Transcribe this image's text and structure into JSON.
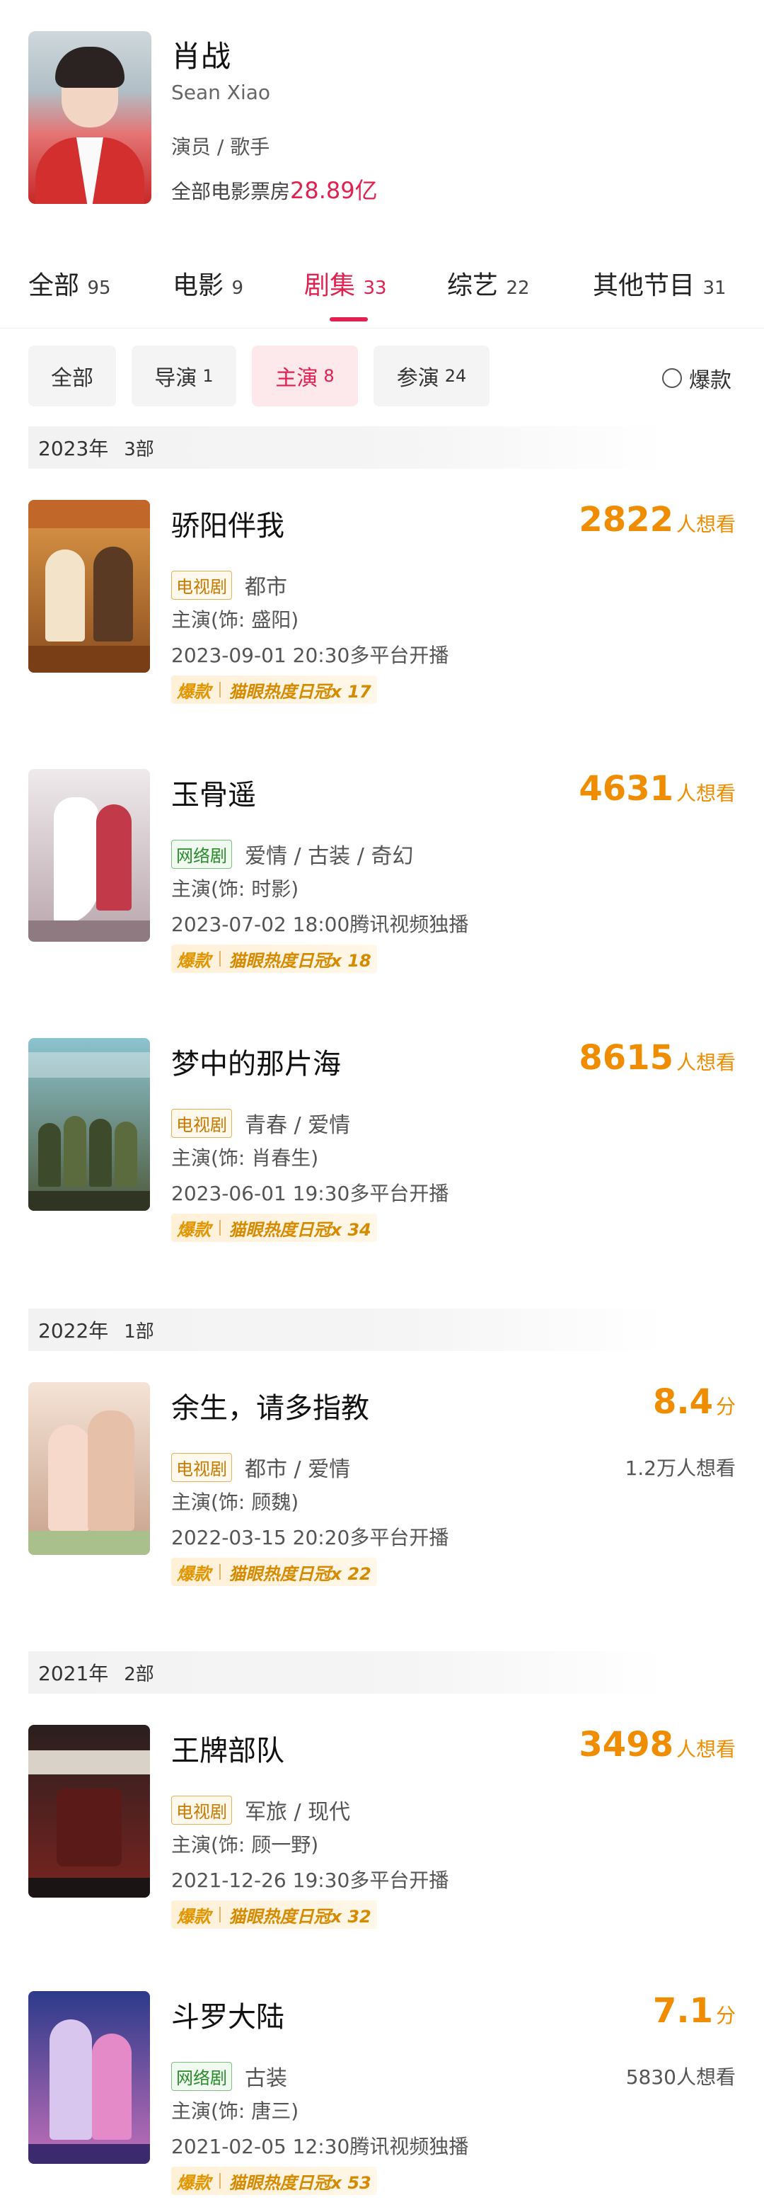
{
  "profile": {
    "name": "肖战",
    "english_name": "Sean Xiao",
    "roles": "演员 / 歌手",
    "boxoffice_label": "全部电影票房",
    "boxoffice_value": "28.89亿"
  },
  "tabs": [
    {
      "label": "全部",
      "count": "95"
    },
    {
      "label": "电影",
      "count": "9"
    },
    {
      "label": "剧集",
      "count": "33"
    },
    {
      "label": "综艺",
      "count": "22"
    },
    {
      "label": "其他节目",
      "count": "31"
    }
  ],
  "active_tab": "剧集",
  "filters": [
    {
      "label": "全部",
      "count": ""
    },
    {
      "label": "导演",
      "count": "1"
    },
    {
      "label": "主演",
      "count": "8"
    },
    {
      "label": "参演",
      "count": "24"
    }
  ],
  "active_filter": "主演",
  "hit_toggle": {
    "label": "爆款",
    "checked": false
  },
  "years": [
    {
      "year": "2023年",
      "count": "3部"
    },
    {
      "year": "2022年",
      "count": "1部"
    },
    {
      "year": "2021年",
      "count": "2部"
    }
  ],
  "shows": [
    {
      "title": "骄阳伴我",
      "rating_value": "2822",
      "rating_unit": "人想看",
      "want": "",
      "badge": "电视剧",
      "badge_type": "tv",
      "genres": "都市",
      "role": "主演(饰: 盛阳)",
      "release": "2023-09-01 20:30多平台开播",
      "hit_label": "爆款",
      "heat": "猫眼热度日冠x 17",
      "poster_colors": [
        "#d98a3a",
        "#8a4d1f"
      ]
    },
    {
      "title": "玉骨遥",
      "rating_value": "4631",
      "rating_unit": "人想看",
      "want": "",
      "badge": "网络剧",
      "badge_type": "web",
      "genres": "爱情 / 古装 / 奇幻",
      "role": "主演(饰: 时影)",
      "release": "2023-07-02 18:00腾讯视频独播",
      "hit_label": "爆款",
      "heat": "猫眼热度日冠x 18",
      "poster_colors": [
        "#e9e4e6",
        "#b9a6ad"
      ]
    },
    {
      "title": "梦中的那片海",
      "rating_value": "8615",
      "rating_unit": "人想看",
      "want": "",
      "badge": "电视剧",
      "badge_type": "tv",
      "genres": "青春 / 爱情",
      "role": "主演(饰: 肖春生)",
      "release": "2023-06-01 19:30多平台开播",
      "hit_label": "爆款",
      "heat": "猫眼热度日冠x 34",
      "poster_colors": [
        "#7fb6c4",
        "#4f5a3c"
      ]
    },
    {
      "title": "余生，请多指教",
      "rating_value": "8.4",
      "rating_unit": "分",
      "want": "1.2万人想看",
      "badge": "电视剧",
      "badge_type": "tv",
      "genres": "都市 / 爱情",
      "role": "主演(饰: 顾魏)",
      "release": "2022-03-15 20:20多平台开播",
      "hit_label": "爆款",
      "heat": "猫眼热度日冠x 22",
      "poster_colors": [
        "#f1ddd0",
        "#c7a08a"
      ]
    },
    {
      "title": "王牌部队",
      "rating_value": "3498",
      "rating_unit": "人想看",
      "want": "",
      "badge": "电视剧",
      "badge_type": "tv",
      "genres": "军旅 / 现代",
      "role": "主演(饰: 顾一野)",
      "release": "2021-12-26 19:30多平台开播",
      "hit_label": "爆款",
      "heat": "猫眼热度日冠x 32",
      "poster_colors": [
        "#3b2a2a",
        "#7a2420"
      ]
    },
    {
      "title": "斗罗大陆",
      "rating_value": "7.1",
      "rating_unit": "分",
      "want": "5830人想看",
      "badge": "网络剧",
      "badge_type": "web",
      "genres": "古装",
      "role": "主演(饰: 唐三)",
      "release": "2021-02-05 12:30腾讯视频独播",
      "hit_label": "爆款",
      "heat": "猫眼热度日冠x 53",
      "poster_colors": [
        "#2c3a8a",
        "#c26fb8"
      ]
    }
  ]
}
